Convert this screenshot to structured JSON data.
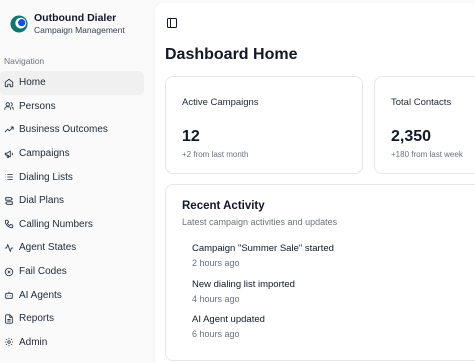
{
  "brand": {
    "title": "Outbound Dialer",
    "subtitle": "Campaign Management",
    "logo_colors": [
      "#0f766e",
      "#1d4ed8"
    ]
  },
  "sidebar": {
    "heading": "Navigation",
    "items": [
      {
        "label": "Home",
        "icon": "home-icon",
        "active": true
      },
      {
        "label": "Persons",
        "icon": "users-icon"
      },
      {
        "label": "Business Outcomes",
        "icon": "trending-up-icon"
      },
      {
        "label": "Campaigns",
        "icon": "megaphone-icon"
      },
      {
        "label": "Dialing Lists",
        "icon": "list-icon"
      },
      {
        "label": "Dial Plans",
        "icon": "route-icon"
      },
      {
        "label": "Calling Numbers",
        "icon": "phone-icon"
      },
      {
        "label": "Agent States",
        "icon": "activity-icon"
      },
      {
        "label": "Fail Codes",
        "icon": "x-circle-icon"
      },
      {
        "label": "AI Agents",
        "icon": "bot-icon"
      },
      {
        "label": "Reports",
        "icon": "file-text-icon"
      },
      {
        "label": "Admin",
        "icon": "settings-icon"
      }
    ]
  },
  "main": {
    "title": "Dashboard Home",
    "stats": [
      {
        "label": "Active Campaigns",
        "value": "12",
        "delta": "+2 from last month"
      },
      {
        "label": "Total Contacts",
        "value": "2,350",
        "delta": "+180 from last week"
      }
    ],
    "activity": {
      "title": "Recent Activity",
      "subtitle": "Latest campaign activities and updates",
      "items": [
        {
          "text": "Campaign \"Summer Sale\" started",
          "time": "2 hours ago"
        },
        {
          "text": "New dialing list imported",
          "time": "4 hours ago"
        },
        {
          "text": "AI Agent updated",
          "time": "6 hours ago"
        }
      ]
    }
  }
}
